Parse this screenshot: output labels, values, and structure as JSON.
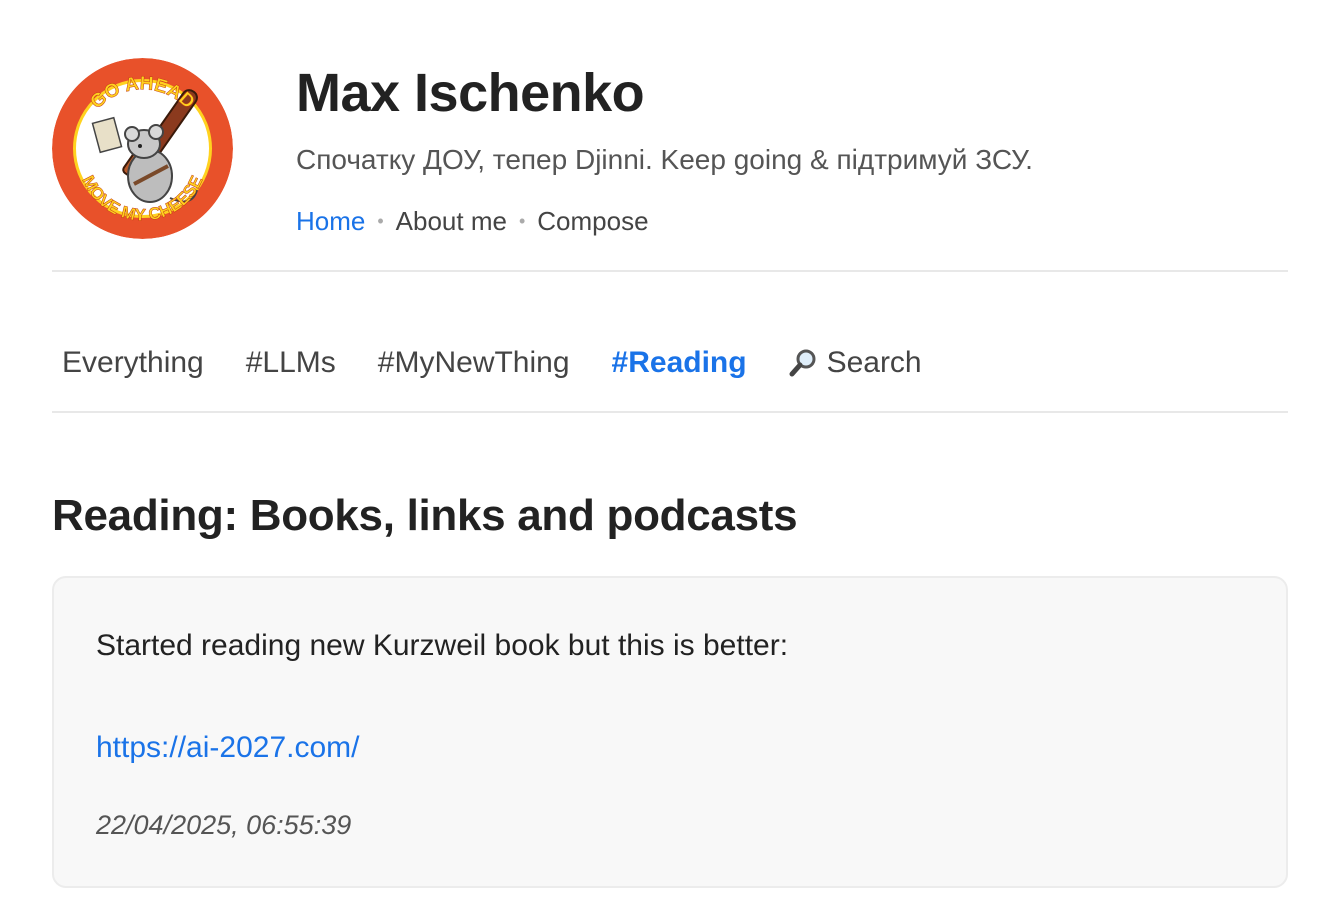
{
  "header": {
    "title": "Max Ischenko",
    "subtitle": "Спочатку ДОУ, тепер Djinni. Keep going & підтримуй ЗСУ.",
    "avatar": {
      "top_text": "GO AHEAD",
      "bottom_text": "MOVE MY CHEESE",
      "colors": {
        "ring": "#e8512a",
        "text": "#ffd21f",
        "inner": "#ffffff"
      }
    },
    "nav": [
      {
        "label": "Home",
        "active": true
      },
      {
        "label": "About me",
        "active": false
      },
      {
        "label": "Compose",
        "active": false
      }
    ]
  },
  "tabs": [
    {
      "label": "Everything",
      "active": false
    },
    {
      "label": "#LLMs",
      "active": false
    },
    {
      "label": "#MyNewThing",
      "active": false
    },
    {
      "label": "#Reading",
      "active": true
    },
    {
      "label": "Search",
      "icon": "search-icon",
      "active": false
    }
  ],
  "section": {
    "title": "Reading: Books, links and podcasts"
  },
  "post": {
    "text": "Started reading new Kurzweil book but this is better:",
    "link": "https://ai-2027.com/",
    "date": "22/04/2025, 06:55:39"
  },
  "colors": {
    "accent": "#1a73e8",
    "text": "#222222",
    "muted": "#555555",
    "card_bg": "#f8f8f8",
    "divider": "#e8e8e8"
  }
}
